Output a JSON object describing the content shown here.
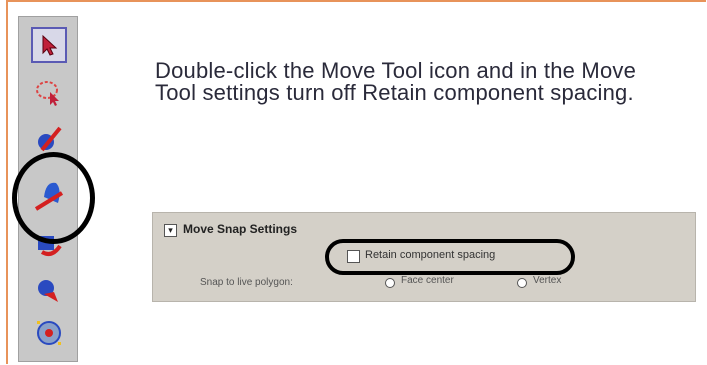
{
  "instruction": {
    "line1": "Double-click the Move Tool icon and in the Move",
    "line2": "Tool settings turn off Retain component spacing."
  },
  "toolbar": {
    "tools": [
      {
        "icon": "select-arrow-icon",
        "selected": true
      },
      {
        "icon": "lasso-select-icon",
        "selected": false
      },
      {
        "icon": "paint-select-icon",
        "selected": false
      },
      {
        "icon": "move-tool-icon",
        "selected": false
      },
      {
        "icon": "rotate-tool-icon",
        "selected": false
      },
      {
        "icon": "scale-tool-icon",
        "selected": false
      },
      {
        "icon": "universal-manipulator-icon",
        "selected": false
      }
    ]
  },
  "panel": {
    "title": "Move Snap Settings",
    "expander": "▾",
    "retain_spacing_label": "Retain component spacing",
    "retain_spacing_checked": false,
    "snap_label": "Snap to live polygon:",
    "radio1_label": "Face center",
    "radio2_label": "Vertex"
  },
  "colors": {
    "frame": "#e8935a",
    "toolbar": "#c8c8c8",
    "panel": "#d4d0c8",
    "highlight": "#000000"
  }
}
